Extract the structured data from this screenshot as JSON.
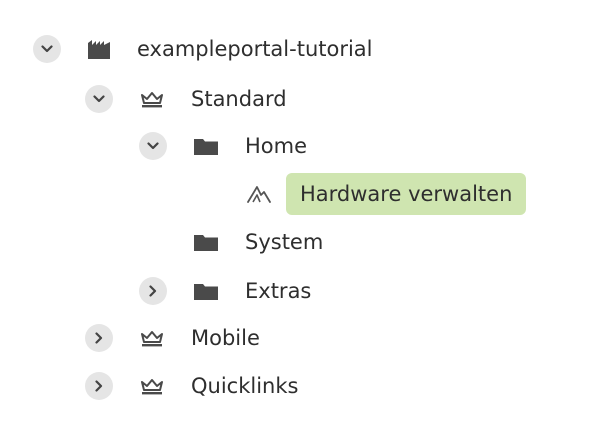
{
  "tree": {
    "root": {
      "label": "exampleportal-tutorial",
      "icon": "portal-icon",
      "expanded": true
    },
    "nodes": [
      {
        "label": "Standard",
        "icon": "crown-icon",
        "expanded": true
      },
      {
        "label": "Home",
        "icon": "folder-icon",
        "expanded": true
      },
      {
        "label": "Hardware verwalten",
        "icon": "application-icon",
        "selected": true
      },
      {
        "label": "System",
        "icon": "folder-icon"
      },
      {
        "label": "Extras",
        "icon": "folder-icon",
        "expanded": false
      },
      {
        "label": "Mobile",
        "icon": "crown-icon",
        "expanded": false
      },
      {
        "label": "Quicklinks",
        "icon": "crown-icon",
        "expanded": false
      }
    ]
  },
  "colors": {
    "selected_bg": "#cfe5b0",
    "icon_dark": "#4a4a4a",
    "toggle_bg": "#e5e5e5"
  }
}
